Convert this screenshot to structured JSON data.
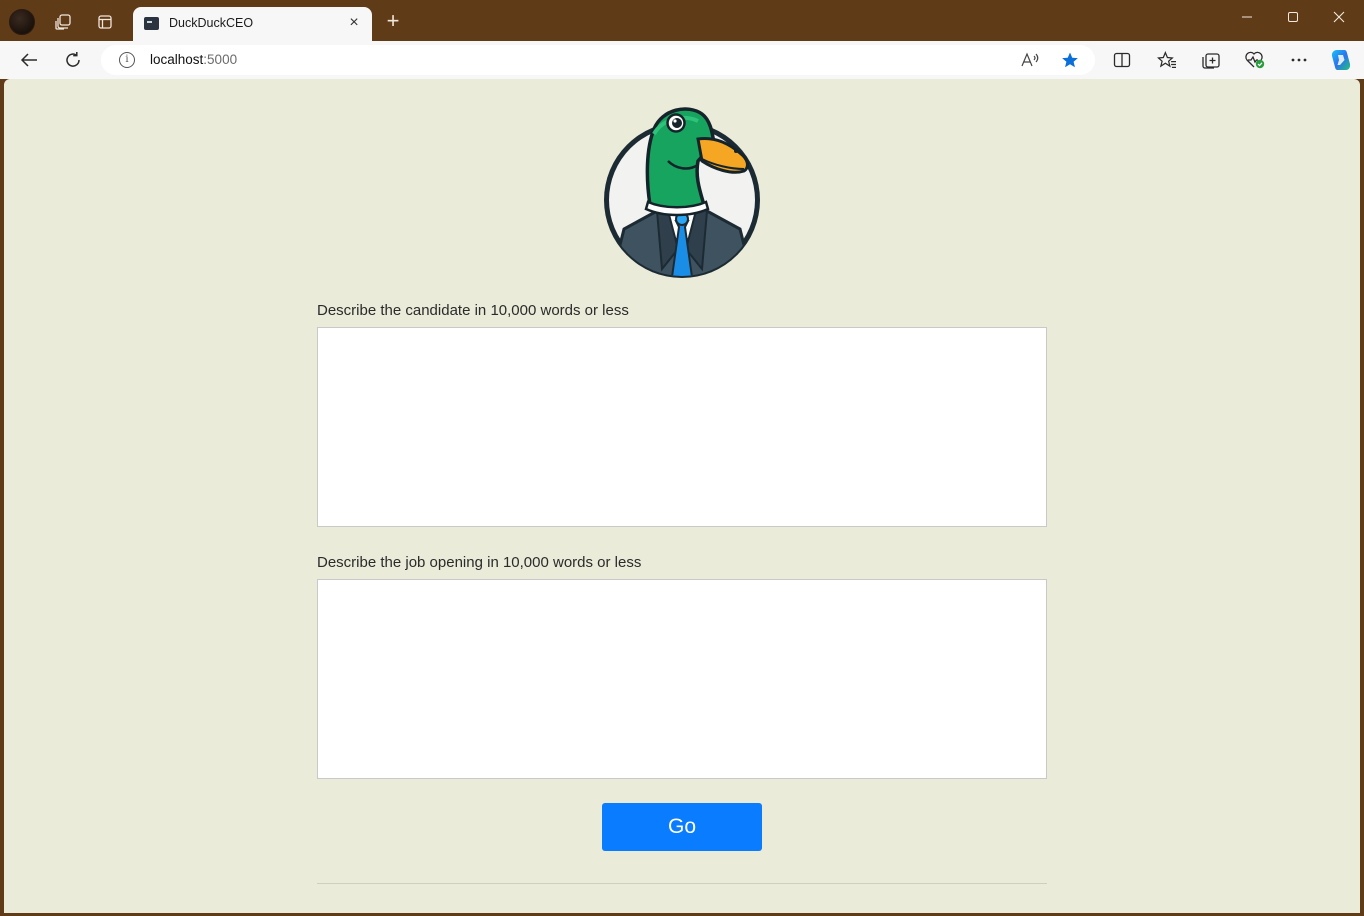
{
  "browser": {
    "tab": {
      "title": "DuckDuckCEO",
      "close_glyph": "×"
    },
    "new_tab_glyph": "+",
    "window_controls": {
      "minimize": "—",
      "maximize": "☐",
      "close": "✕"
    },
    "address": {
      "host": "localhost",
      "port": ":5000"
    },
    "icons": {
      "profile": "profile-avatar-icon",
      "workspaces": "workspaces-icon",
      "tab_actions": "tab-actions-icon",
      "back": "back-arrow-icon",
      "refresh": "refresh-icon",
      "site_info": "info-icon",
      "read_aloud": "read-aloud-icon",
      "favorite": "star-filled-icon",
      "split_screen": "split-screen-icon",
      "favorites": "favorites-icon",
      "collections": "collections-icon",
      "browser_essentials": "browser-essentials-icon",
      "more": "more-icon",
      "copilot": "copilot-icon"
    },
    "colors": {
      "frame": "#5f3b17",
      "favorite_star": "#0a6fd8"
    }
  },
  "page": {
    "background": "#eaebd8",
    "logo_icon": "duck-ceo-logo",
    "candidate": {
      "label": "Describe the candidate in 10,000 words or less",
      "value": ""
    },
    "job": {
      "label": "Describe the job opening in 10,000 words or less",
      "value": ""
    },
    "submit": {
      "label": "Go",
      "color": "#0a7cff"
    }
  }
}
